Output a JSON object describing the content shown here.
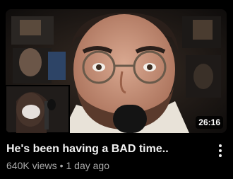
{
  "video": {
    "title": "He's been having a BAD time..",
    "views": "640K views",
    "separator": "•",
    "age": "1 day ago",
    "duration": "26:16"
  },
  "icons": {
    "menu": "more-vert-icon"
  },
  "colors": {
    "background": "#000000",
    "title": "#f1f1f1",
    "meta": "#aaaaaa",
    "duration_bg": "#000000"
  }
}
